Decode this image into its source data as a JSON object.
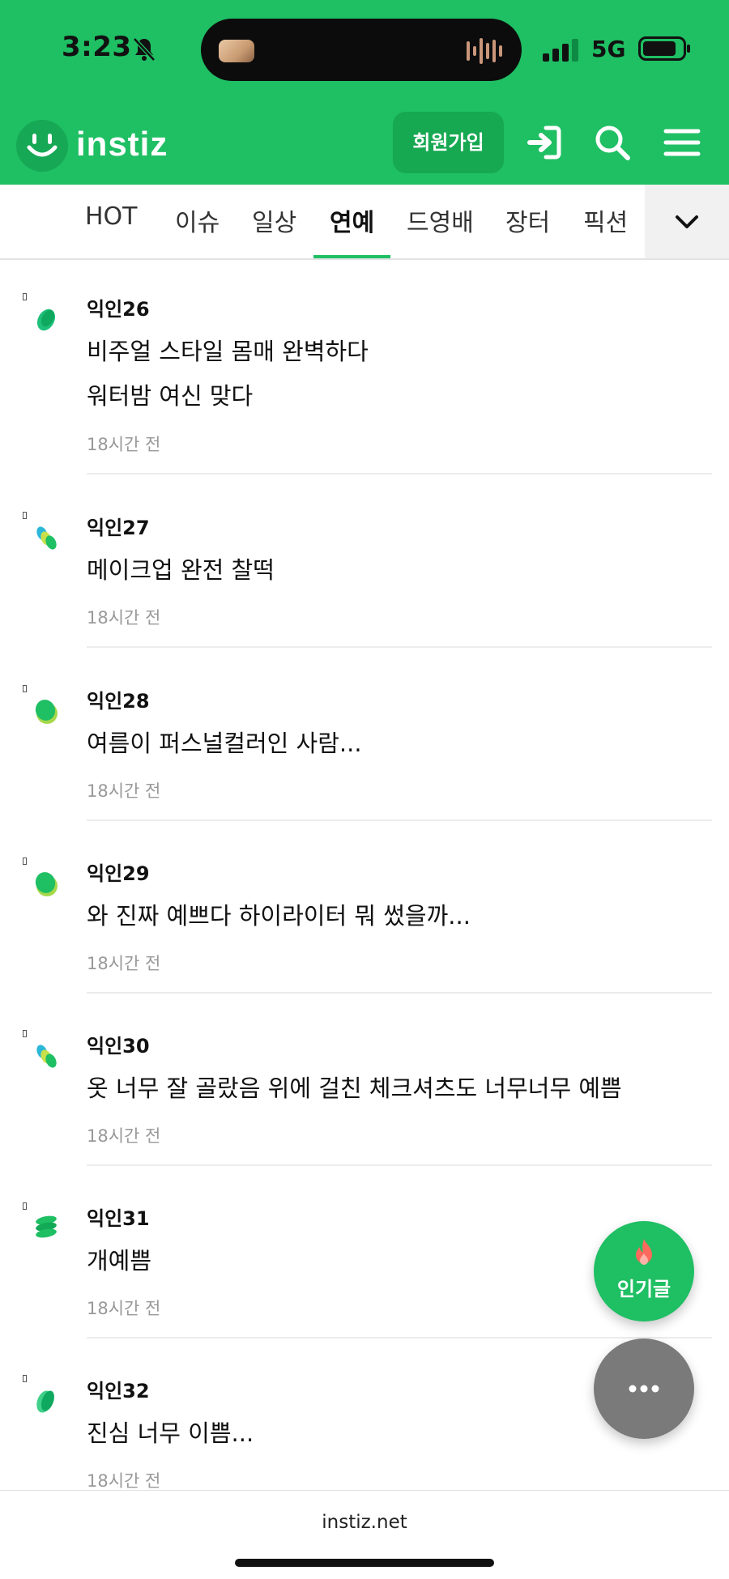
{
  "status_bar": {
    "time": "3:23",
    "network": "5G",
    "icons": [
      "bell-mute-icon",
      "signal-icon",
      "battery-icon"
    ]
  },
  "header": {
    "logo_text": "instiz",
    "join_label": "회원가입",
    "icons": [
      "login-icon",
      "search-icon",
      "menu-icon"
    ],
    "colors": {
      "brand_green": "#1fbf63",
      "button_green": "#17a852"
    }
  },
  "tabs": {
    "items": [
      "HOT",
      "이슈",
      "일상",
      "연예",
      "드영배",
      "장터",
      "픽션"
    ],
    "active": "연예",
    "more_icon": "chevron-down-icon"
  },
  "comments": [
    {
      "author": "익인26",
      "lines": [
        "비주얼 스타일 몸매 완벽하다",
        "워터밤 여신 맞다"
      ],
      "time": "18시간 전"
    },
    {
      "author": "익인27",
      "lines": [
        "메이크업 완전 찰떡"
      ],
      "time": "18시간 전"
    },
    {
      "author": "익인28",
      "lines": [
        "여름이 퍼스널컬러인 사람..."
      ],
      "time": "18시간 전"
    },
    {
      "author": "익인29",
      "lines": [
        "와 진짜 예쁘다 하이라이터 뭐 썼을까..."
      ],
      "time": "18시간 전"
    },
    {
      "author": "익인30",
      "lines": [
        "옷 너무 잘 골랐음 위에 걸친 체크셔츠도 너무너무 예쁨"
      ],
      "time": "18시간 전"
    },
    {
      "author": "익인31",
      "lines": [
        "개예쁨"
      ],
      "time": "18시간 전"
    },
    {
      "author": "익인32",
      "lines": [
        "진심 너무 이쁨..."
      ],
      "time": "18시간 전"
    }
  ],
  "fab": {
    "hot_label": "인기글",
    "hot_icon": "flame-icon",
    "more_icon": "more-dots-icon"
  },
  "footer": {
    "domain": "instiz.net"
  }
}
